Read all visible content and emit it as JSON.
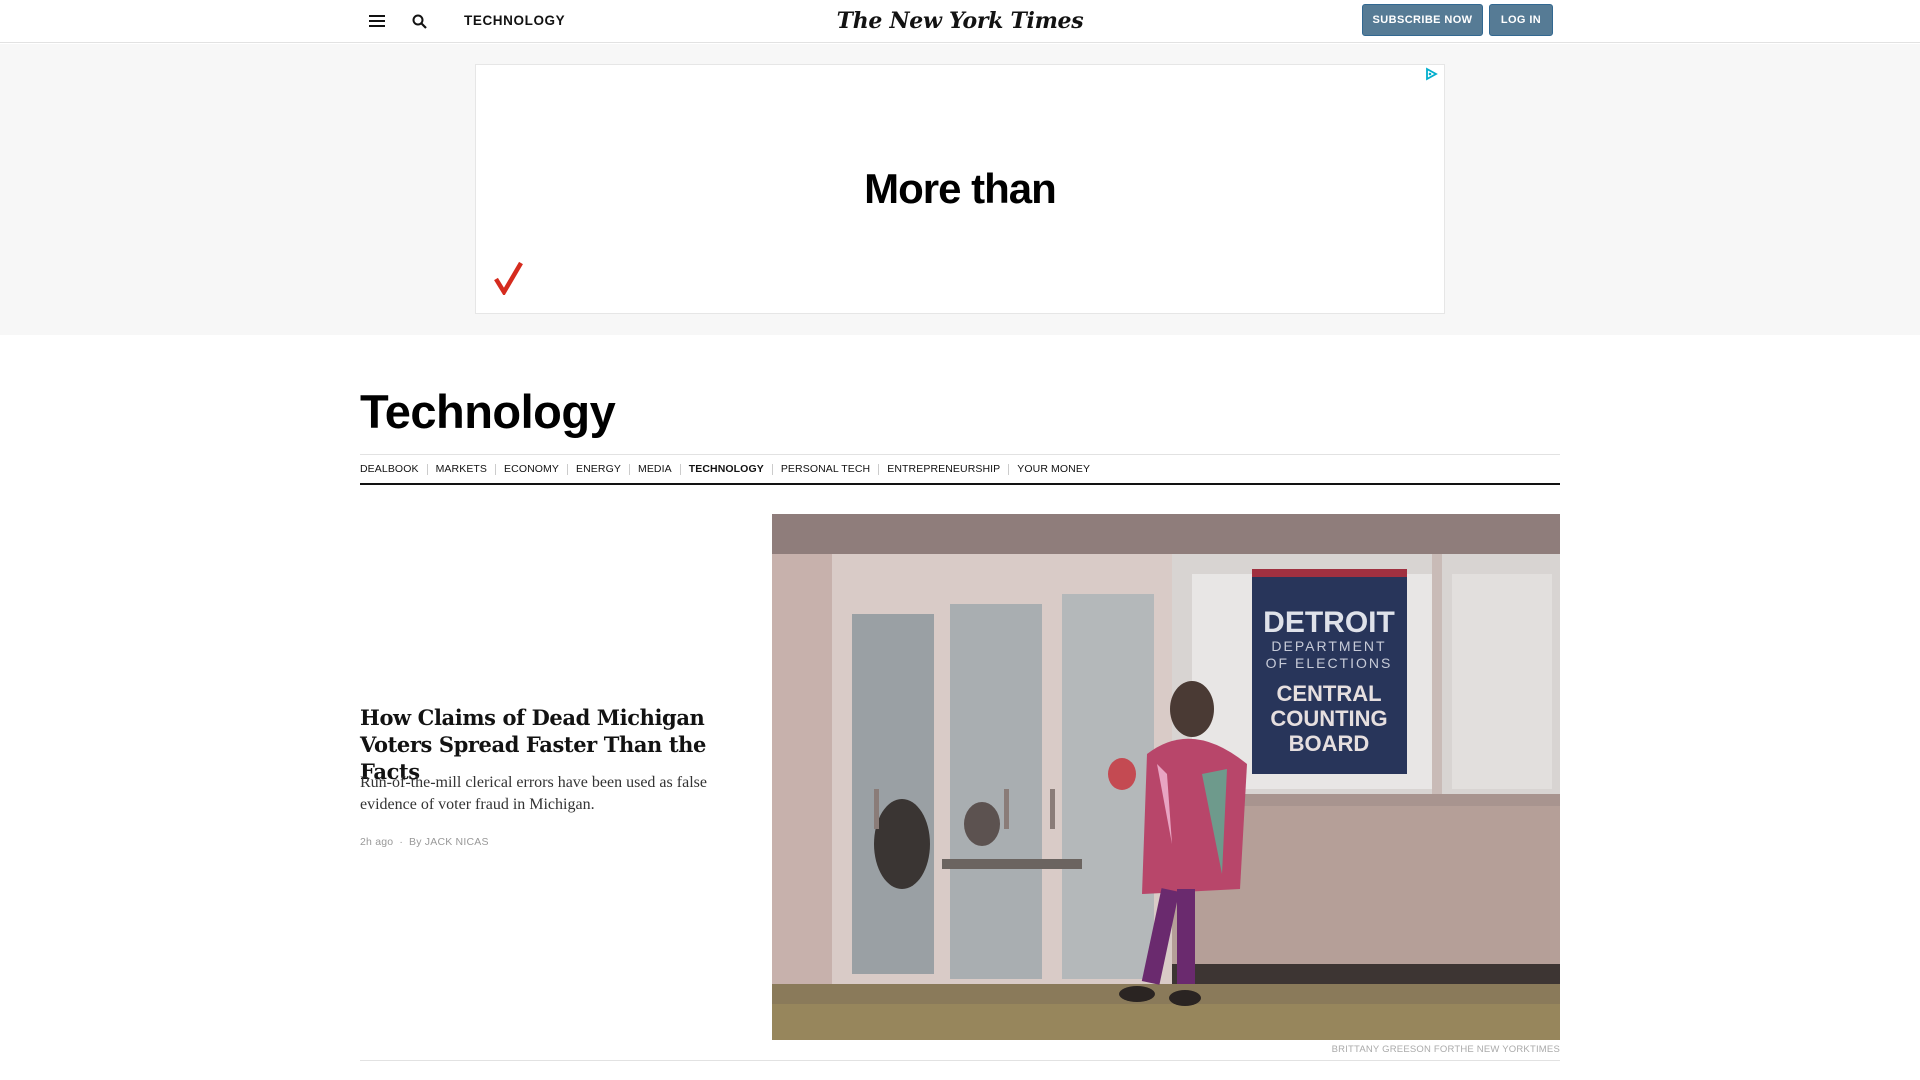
{
  "masthead": {
    "section_label": "TECHNOLOGY",
    "logo_text": "The New York Times",
    "subscribe_label": "SUBSCRIBE NOW",
    "login_label": "LOG IN",
    "accent_color": "#567b95"
  },
  "ad": {
    "text": "More than"
  },
  "section": {
    "title": "Technology",
    "subnav": [
      {
        "label": "DEALBOOK",
        "active": false
      },
      {
        "label": "MARKETS",
        "active": false
      },
      {
        "label": "ECONOMY",
        "active": false
      },
      {
        "label": "ENERGY",
        "active": false
      },
      {
        "label": "MEDIA",
        "active": false
      },
      {
        "label": "TECHNOLOGY",
        "active": true
      },
      {
        "label": "PERSONAL TECH",
        "active": false
      },
      {
        "label": "ENTREPRENEURSHIP",
        "active": false
      },
      {
        "label": "YOUR MONEY",
        "active": false
      }
    ]
  },
  "lead_story": {
    "headline": "How Claims of Dead Michigan Voters Spread Faster Than the Facts",
    "summary": "Run-of-the-mill clerical errors have been used as false evidence of voter fraud in Michigan.",
    "timestamp": "2h ago",
    "byline": "By JACK NICAS",
    "photo": {
      "sign_line1": "DETROIT",
      "sign_line2": "DEPARTMENT",
      "sign_line3": "OF ELECTIONS",
      "sign_line4": "CENTRAL",
      "sign_line5": "COUNTING",
      "sign_line6": "BOARD"
    },
    "photo_credit": "BRITTANY GREESON FORTHE NEW YORKTIMES"
  }
}
